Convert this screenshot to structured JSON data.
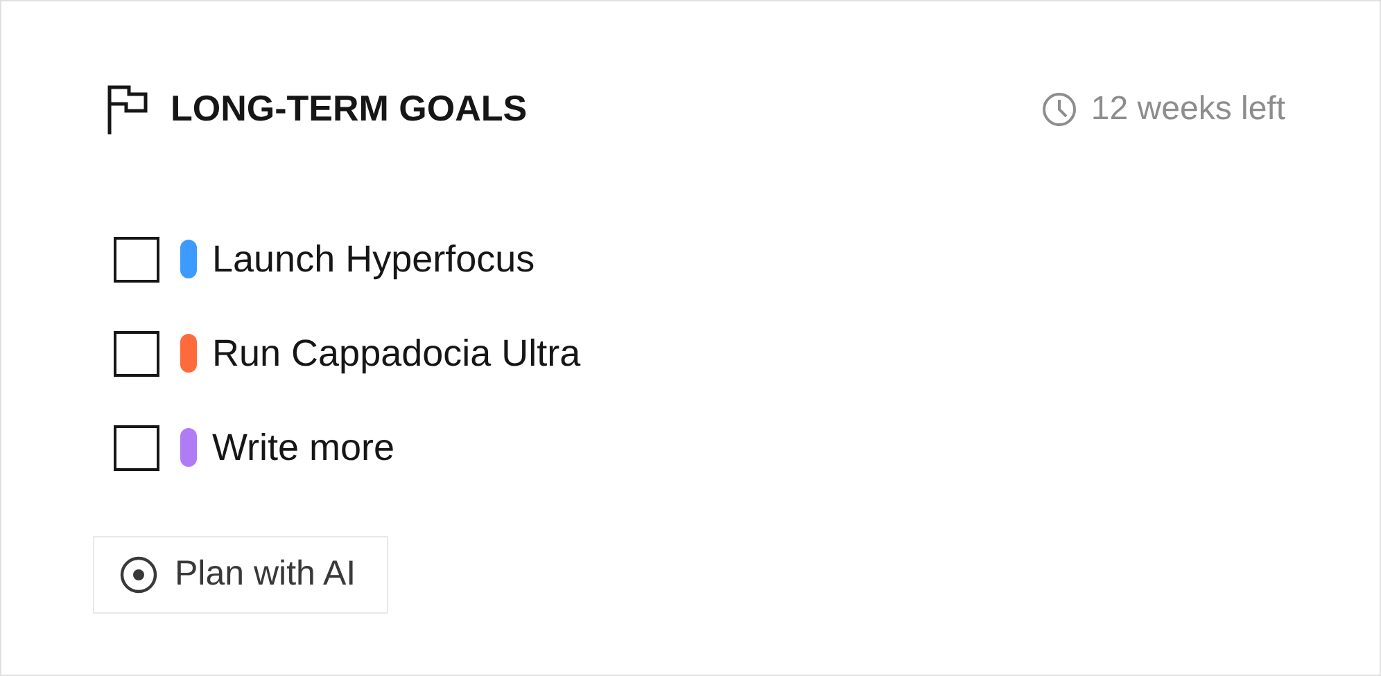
{
  "header": {
    "title": "LONG-TERM GOALS",
    "time_left": "12 weeks left"
  },
  "goals": [
    {
      "label": "Launch Hyperfocus",
      "checked": false,
      "color": "#3d9bff"
    },
    {
      "label": "Run Cappadocia Ultra",
      "checked": false,
      "color": "#ff6a3d"
    },
    {
      "label": "Write more",
      "checked": false,
      "color": "#b07cf5"
    }
  ],
  "action": {
    "label": "Plan with AI"
  }
}
